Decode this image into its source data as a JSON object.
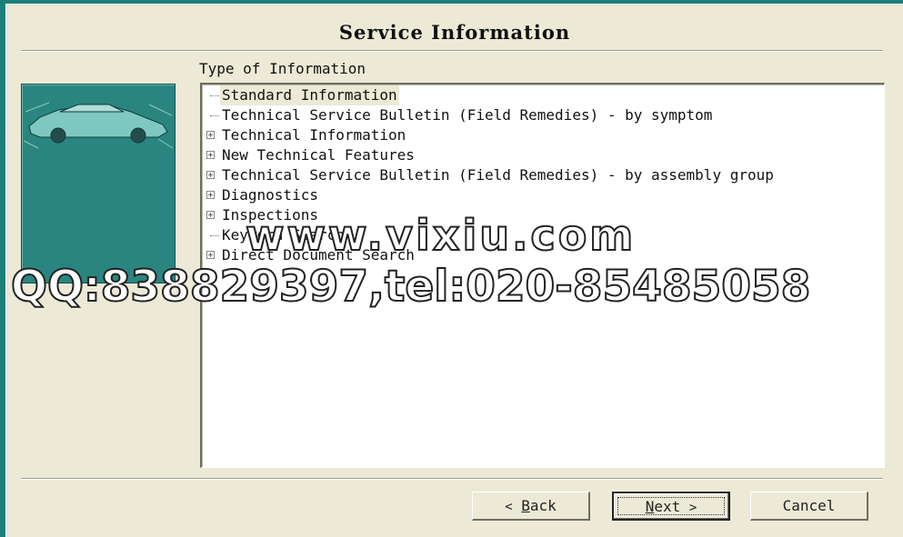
{
  "dialog": {
    "title": "Service Information",
    "section_label": "Type of Information"
  },
  "tree": {
    "items": [
      {
        "label": "Standard Information",
        "expandable": false,
        "selected": true
      },
      {
        "label": "Technical Service Bulletin (Field Remedies) -  by symptom",
        "expandable": false,
        "selected": false
      },
      {
        "label": "Technical Information",
        "expandable": true,
        "selected": false
      },
      {
        "label": "New Technical Features",
        "expandable": true,
        "selected": false
      },
      {
        "label": "Technical Service Bulletin (Field Remedies) -  by assembly group",
        "expandable": true,
        "selected": false
      },
      {
        "label": "Diagnostics",
        "expandable": true,
        "selected": false
      },
      {
        "label": "Inspections",
        "expandable": true,
        "selected": false
      },
      {
        "label": "Keyword Search",
        "expandable": false,
        "selected": false
      },
      {
        "label": "Direct Document Search",
        "expandable": true,
        "selected": false
      }
    ]
  },
  "buttons": {
    "back": {
      "arrow": "<",
      "mnemonic": "B",
      "rest": "ack"
    },
    "next": {
      "mnemonic": "N",
      "rest": "ext",
      "arrow": ">"
    },
    "cancel": "Cancel"
  },
  "watermark": {
    "site": "www.vixiu.com",
    "contact": "QQ:838829397,tel:020-85485058"
  },
  "colors": {
    "desktop": "#1c7f7a",
    "dialog_bg": "#ecead6",
    "image_panel": "#2a8580"
  },
  "icons": {
    "expander": "plus-box-icon",
    "sidebar_image": "car-illustration"
  }
}
